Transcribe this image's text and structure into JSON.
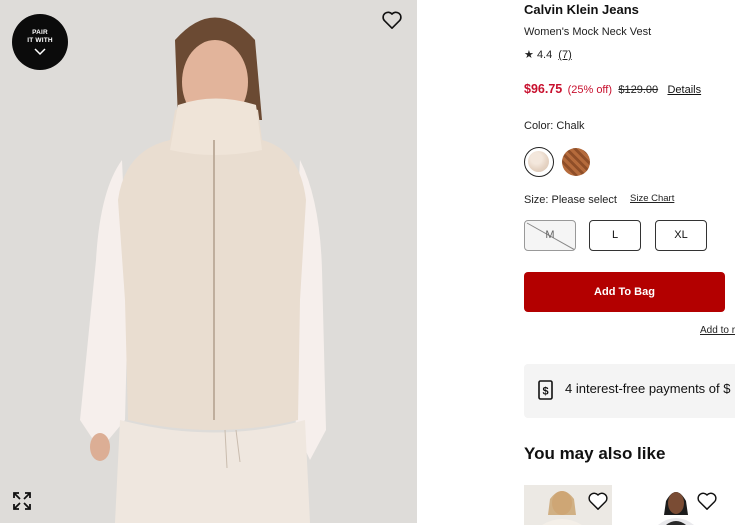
{
  "gallery": {
    "pair_button": {
      "line1": "PAIR",
      "line2": "IT WITH",
      "icon": "chevron-down-icon"
    },
    "wishlist_icon": "heart-icon",
    "expand_icon": "expand-icon"
  },
  "product": {
    "brand": "Calvin Klein Jeans",
    "name": "Women's Mock Neck Vest",
    "rating": "4.4",
    "review_count": "(7)",
    "price_sale": "$96.75",
    "price_off": "(25% off)",
    "price_original": "$129.00",
    "details_link": "Details"
  },
  "color": {
    "label": "Color: Chalk",
    "swatches": [
      {
        "name": "Chalk",
        "color": "#e8d8ca",
        "selected": true
      },
      {
        "name": "Brown",
        "color": "#a05a30",
        "selected": false
      }
    ]
  },
  "size": {
    "label": "Size: Please select",
    "chart_link": "Size Chart",
    "options": [
      {
        "label": "M",
        "available": false
      },
      {
        "label": "L",
        "available": true
      },
      {
        "label": "XL",
        "available": true
      }
    ]
  },
  "actions": {
    "add_to_bag": "Add To Bag",
    "add_to_registry": "Add to r"
  },
  "payment": {
    "text": "4 interest-free payments of $"
  },
  "recommendations": {
    "title": "You may also like"
  },
  "colors": {
    "accent_red": "#b30000",
    "sale_red": "#c8102e"
  }
}
